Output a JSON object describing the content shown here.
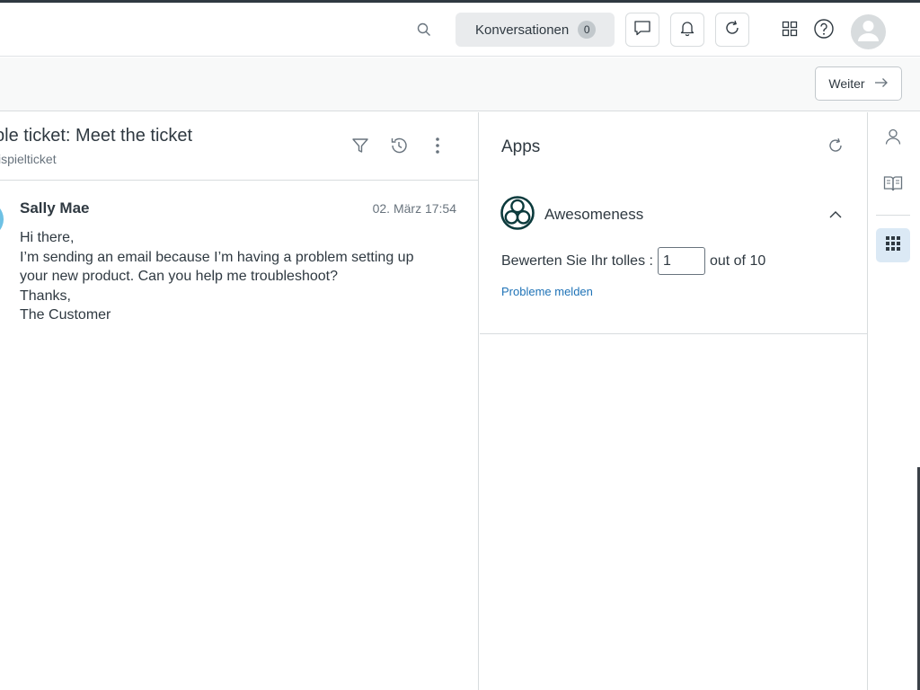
{
  "topbar": {
    "search_icon": "search-icon",
    "conversations_label": "Konversationen",
    "conversations_count": "0",
    "icons": [
      "chat-icon",
      "bell-icon",
      "refresh-icon",
      "apps-grid-icon",
      "help-icon",
      "avatar-icon"
    ]
  },
  "subbar": {
    "next_label": "Weiter"
  },
  "ticket": {
    "title": "ple ticket: Meet the ticket",
    "subtitle": "ispielticket"
  },
  "message": {
    "author": "Sally Mae",
    "time": "02. März 17:54",
    "lines": [
      "Hi there,",
      "I’m sending an email because I’m having a problem setting up",
      "your new product. Can you help me troubleshoot?",
      "Thanks,",
      "The Customer"
    ]
  },
  "apps": {
    "title": "Apps",
    "app_name": "Awesomeness",
    "rate_prefix": "Bewerten Sie Ihr tolles :",
    "rate_value": "1",
    "rate_suffix": "out of 10",
    "report_link": "Probleme melden"
  },
  "colors": {
    "accent_link": "#1f73b7",
    "active_rail_bg": "#dbe9f5",
    "avatar_blue": "#6ec1e4"
  }
}
